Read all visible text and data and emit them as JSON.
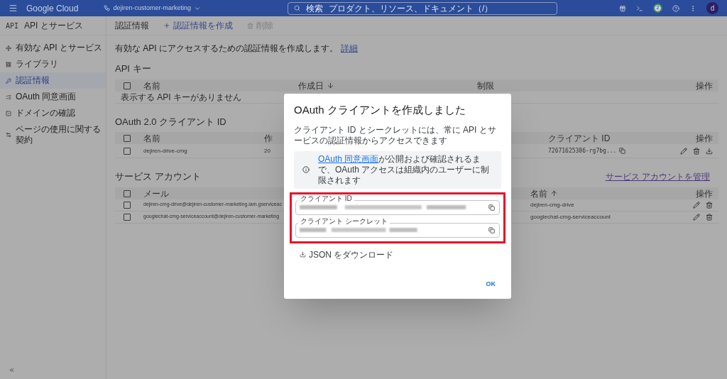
{
  "topbar": {
    "product": "Google Cloud",
    "project": "dejiren-customer-marketing",
    "search_label": "検索",
    "search_placeholder": "プロダクト、リソース、ドキュメント（/）",
    "notification_count": "2",
    "avatar": "d"
  },
  "sidebar": {
    "badge": "API",
    "title": "API とサービス",
    "items": [
      {
        "label": "有効な API とサービス",
        "selected": false
      },
      {
        "label": "ライブラリ",
        "selected": false
      },
      {
        "label": "認証情報",
        "selected": true
      },
      {
        "label": "OAuth 同意画面",
        "selected": false
      },
      {
        "label": "ドメインの確認",
        "selected": false
      },
      {
        "label": "ページの使用に関する契約",
        "selected": false
      }
    ]
  },
  "page": {
    "title": "認証情報",
    "actions": [
      {
        "kind": "create",
        "label": "認証情報を作成",
        "disabled": false
      },
      {
        "kind": "delete",
        "label": "削除",
        "disabled": true
      }
    ],
    "description": "有効な API にアクセスするための認証情報を作成します。",
    "description_link": "詳細"
  },
  "api_keys": {
    "title": "API キー",
    "all_checked": false,
    "columns": [
      {
        "label": "名前",
        "sorted": false
      },
      {
        "label": "作成日",
        "sorted": true,
        "ascending": false
      },
      {
        "label": "制限",
        "sorted": false
      },
      {
        "label": "操作",
        "sorted": false
      }
    ],
    "empty": "表示する API キーがありません"
  },
  "oauth_clients": {
    "title": "OAuth 2.0 クライアント ID",
    "all_checked": false,
    "columns": [
      {
        "label": "名前",
        "sorted": false
      },
      {
        "label": "作",
        "sorted": false
      },
      {
        "label": "クライアント ID",
        "sorted": false
      },
      {
        "label": "操作",
        "sorted": false
      }
    ],
    "rows": [
      {
        "name": "dejiren-drive-cmg",
        "created": "20",
        "client_id": "72671625386-rg7bg...",
        "checked": false
      }
    ]
  },
  "service_accounts": {
    "title": "サービス アカウント",
    "manage_link": "サービス アカウントを管理",
    "all_checked": false,
    "columns": [
      {
        "label": "メール",
        "sorted": false
      },
      {
        "label": "名前",
        "sorted": true,
        "ascending": true
      },
      {
        "label": "操作",
        "sorted": false
      }
    ],
    "rows": [
      {
        "email": "dejiren-cmg-drive@dejiren-customer-marketing.iam.gserviceac",
        "name": "dejiren-cmg-drive",
        "checked": false
      },
      {
        "email": "googlechat-cmg-serviceaccount@dejiren-customer-marketing",
        "name": "googlechat-cmg-serviceaccount",
        "checked": false
      }
    ]
  },
  "dialog": {
    "title": "OAuth クライアントを作成しました",
    "description": "クライアント ID とシークレットには、常に API とサービスの認証情報からアクセスできます",
    "notice": {
      "link": "OAuth 同意画面",
      "text": "が公開および確認されるまで、OAuth アクセスは組織内のユーザーに制限されます"
    },
    "highlighted": true,
    "fields": [
      {
        "label": "クライアント ID"
      },
      {
        "label": "クライアント シークレット"
      }
    ],
    "download": "JSON をダウンロード",
    "ok": "OK"
  }
}
